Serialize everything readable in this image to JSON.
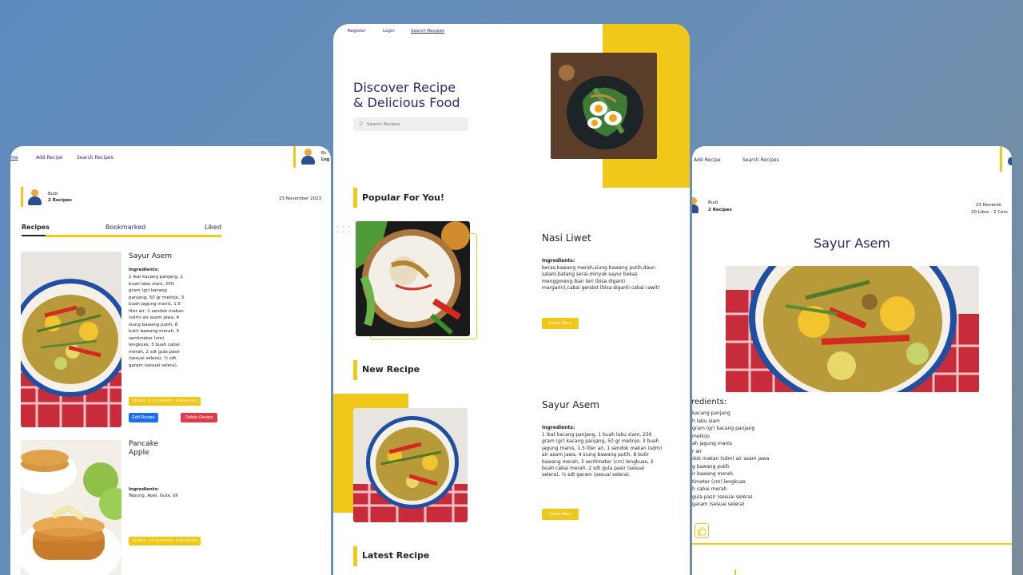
{
  "left": {
    "nav": {
      "home": "me",
      "add_recipe": "Add Recipe",
      "search_recipes": "Search Recipes"
    },
    "user": {
      "name": "Budi",
      "recipes": "2 Recipes",
      "date": "23 November 2023",
      "corner_name": "Bu",
      "corner_action": "Log"
    },
    "tabs": [
      "Recipes",
      "Bookmarked",
      "Liked"
    ],
    "recipes": [
      {
        "title": "Sayur Asem",
        "ingredients_label": "Ingredients:",
        "ingredients": "1 ikat kacang panjang, 1 buah labu siam, 250 gram (gr) kacang panjang, 50 gr melinjo, 3 buah jagung manis, 1.5 liter air, 1 sendok makan (sdm) air asam jawa, 4 siung bawang putih, 8 butir bawang merah, 3 sentimeter (cm) lengkuas, 3 buah cabai merah, 2 sdt gula pasir (sesuai selera), ½ sdt garam (sesuai selera).",
        "stats": "10 likes - 12 Comment - 0 bookmark",
        "edit": "Edit Recipe",
        "delete": "Delete Recipe"
      },
      {
        "title": "Pancake Apple",
        "ingredients_label": "Ingredients:",
        "ingredients": "Tepung, Apel, Gula, dll",
        "stats": "10 likes - 12 Comment - 0 bookmark"
      }
    ]
  },
  "center": {
    "nav": {
      "register": "Register",
      "login": "Login",
      "search_recipes": "Search Recipes"
    },
    "hero": {
      "line1": "Discover Recipe",
      "line2": "& Delicious Food",
      "search_placeholder": "Search Recipes"
    },
    "popular": {
      "section": "Popular For You!",
      "title": "Nasi Liwet",
      "ingredients_label": "Ingredients:",
      "ingredients": "beras,bawang merah,siung bawang putih,daun salam,batang serai,minyak sayur bekas menggoreng ikan teri (bisa diganti margarin),cabai gendot (bisa diganti cabai rawit)",
      "button": "Learn More"
    },
    "new": {
      "section": "New Recipe",
      "title": "Sayur Asem",
      "ingredients_label": "Ingredients:",
      "ingredients": "1 ikat kacang panjang, 1 buah labu siam, 250 gram (gr) kacang panjang, 50 gr melinjo, 3 buah jagung manis, 1.5 liter air, 1 sendok makan (sdm) air asam jawa, 4 siung bawang putih, 8 butir bawang merah, 3 sentimeter (cm) lengkuas, 3 buah cabai merah, 2 sdt gula pasir (sesuai selera), ½ sdt garam (sesuai selera).",
      "button": "Learn More"
    },
    "latest": {
      "section": "Latest Recipe"
    }
  },
  "right": {
    "nav": {
      "add_recipe": "Add Recipe",
      "search_recipes": "Search Recipes"
    },
    "user": {
      "name": "Budi",
      "recipes": "2 Recipes",
      "date": "23 Novemb",
      "stats": "20 Likes - 2 Com"
    },
    "title": "Sayur Asem",
    "ingredients_label": "redients:",
    "ingredient_lines": [
      "kacang panjang",
      "h labu siam",
      "gram (gr) kacang panjang",
      "melinjo",
      "ah jagung manis",
      "r air",
      "dok makan (sdm) air asam jawa",
      "g bawang putih",
      "ir bawang merah",
      "timeter (cm) lengkuas",
      "h cabai merah",
      "gula pasir (sesuai selera)",
      "garam (sesuai selera)"
    ]
  }
}
